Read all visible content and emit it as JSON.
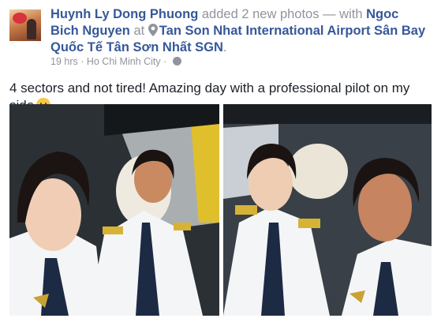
{
  "post": {
    "author": "Huynh Ly Dong Phuong",
    "action": " added 2 new photos — with ",
    "tagged": "Ngoc Bich Nguyen",
    "at_word": " at ",
    "place": "Tan Son Nhat International Airport Sân Bay Quốc Tế Tân Sơn Nhất SGN",
    "place_end": ".",
    "time": "19 hrs",
    "separator": " · ",
    "city": "Ho Chi Minh City",
    "separator2": " · ",
    "caption": "4 sectors and not tired! Amazing day with a professional pilot on my side"
  },
  "icons": {
    "location": "map-pin-icon",
    "privacy": "globe-icon",
    "emoji": "smiley-emoji-icon"
  },
  "colors": {
    "link": "#365899",
    "meta": "#90949c",
    "text": "#1d2129"
  }
}
